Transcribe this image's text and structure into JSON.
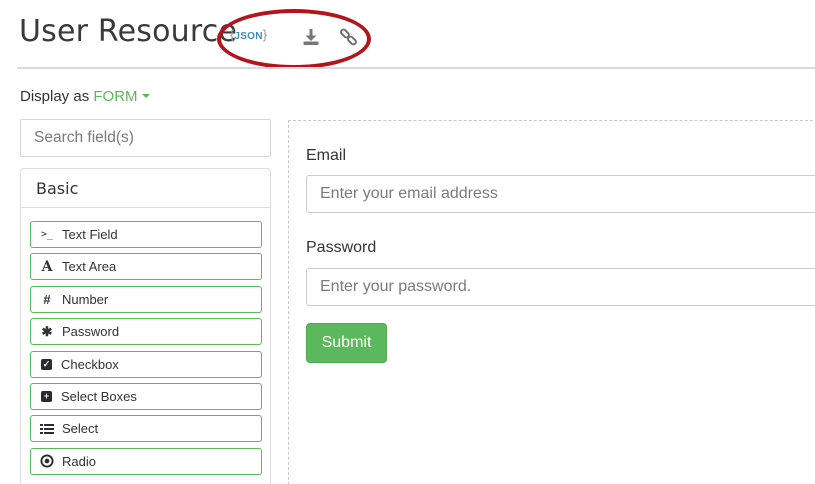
{
  "page": {
    "title": "User Resource",
    "toolbar": {
      "json_icon": "json-braces-icon",
      "json_label": "JSON",
      "download_icon": "download-icon",
      "link_icon": "link-icon"
    },
    "annotation": {
      "color": "#b3151d"
    }
  },
  "display": {
    "label": "Display as",
    "value": "FORM"
  },
  "sidebar": {
    "search": {
      "placeholder": "Search field(s)",
      "value": ""
    },
    "group": {
      "title": "Basic",
      "components": [
        {
          "label": "Text Field",
          "icon": "terminal-icon"
        },
        {
          "label": "Text Area",
          "icon": "font-icon"
        },
        {
          "label": "Number",
          "icon": "hashtag-icon"
        },
        {
          "label": "Password",
          "icon": "asterisk-icon"
        },
        {
          "label": "Checkbox",
          "icon": "check-square-icon"
        },
        {
          "label": "Select Boxes",
          "icon": "plus-square-icon"
        },
        {
          "label": "Select",
          "icon": "list-icon"
        },
        {
          "label": "Radio",
          "icon": "dot-circle-icon"
        }
      ]
    }
  },
  "form": {
    "email": {
      "label": "Email",
      "placeholder": "Enter your email address",
      "value": ""
    },
    "password": {
      "label": "Password",
      "placeholder": "Enter your password.",
      "value": ""
    },
    "submit_label": "Submit"
  },
  "colors": {
    "accent": "#5cb85c",
    "link": "#3a8fb7",
    "annotation": "#b3151d"
  }
}
